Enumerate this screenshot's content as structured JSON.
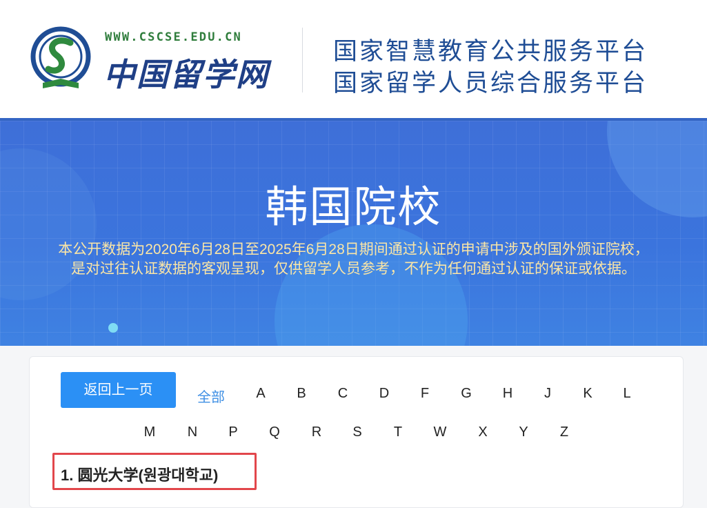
{
  "header": {
    "logo_url_text": "WWW.CSCSE.EDU.CN",
    "logo_cn_text": "中国留学网",
    "platform_line1": "国家智慧教育公共服务平台",
    "platform_line2": "国家留学人员综合服务平台",
    "colors": {
      "logo_blue": "#1f3f86",
      "logo_green": "#2f7d3c",
      "platform_blue": "#1f4d95"
    }
  },
  "banner": {
    "title": "韩国院校",
    "note_line1": "本公开数据为2020年6月28日至2025年6月28日期间通过认证的申请中涉及的国外颁证院校，",
    "note_line2": "是对过往认证数据的客观呈现，仅供留学人员参考，不作为任何通过认证的保证或依据。",
    "colors": {
      "background": "#3b74dd",
      "note": "#fbe6a6"
    }
  },
  "nav": {
    "back_label": "返回上一页",
    "all_label": "全部",
    "letters_row1": [
      "A",
      "B",
      "C",
      "D",
      "F",
      "G",
      "H",
      "J",
      "K",
      "L"
    ],
    "letters_row2": [
      "M",
      "N",
      "P",
      "Q",
      "R",
      "S",
      "T",
      "W",
      "X",
      "Y",
      "Z"
    ],
    "colors": {
      "button": "#2b90f5",
      "all": "#3f8fe4"
    }
  },
  "results": [
    {
      "index": "1.",
      "name": "圆光大学(원광대학교)"
    }
  ],
  "highlight_color": "#e2464b"
}
